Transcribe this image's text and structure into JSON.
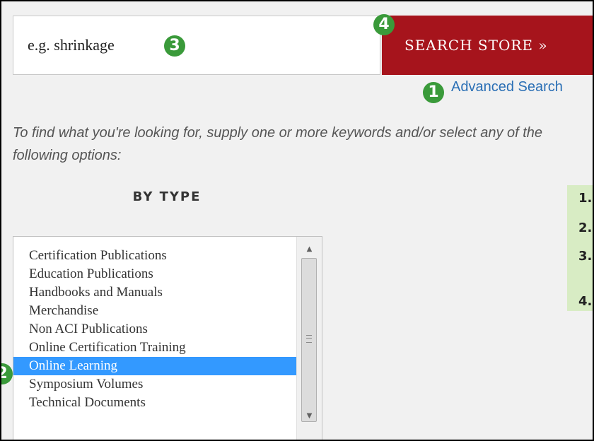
{
  "search": {
    "placeholder": "e.g. shrinkage",
    "button_label": "SEARCH STORE »",
    "advanced_link": "Advanced Search"
  },
  "callouts": [
    "1",
    "2",
    "3",
    "4"
  ],
  "help_text": "To find what you're looking for, supply one or more keywords and/or select any of the following options:",
  "by_type": {
    "heading": "BY TYPE",
    "selected": "Online Learning",
    "options": [
      "Certification Publications",
      "Education Publications",
      "Handbooks and Manuals",
      "Merchandise",
      "Non ACI Publications",
      "Online Certification Training",
      "Online Learning",
      "Symposium Volumes",
      "Technical Documents"
    ]
  },
  "steps_panel": {
    "items": [
      "1.",
      "2.",
      "3.",
      "4."
    ]
  },
  "colors": {
    "accent_red": "#a6141c",
    "badge_green": "#3a9a3a",
    "selection_blue": "#3399ff",
    "link_blue": "#2a6fb5",
    "panel_green": "#d8ecc4"
  }
}
